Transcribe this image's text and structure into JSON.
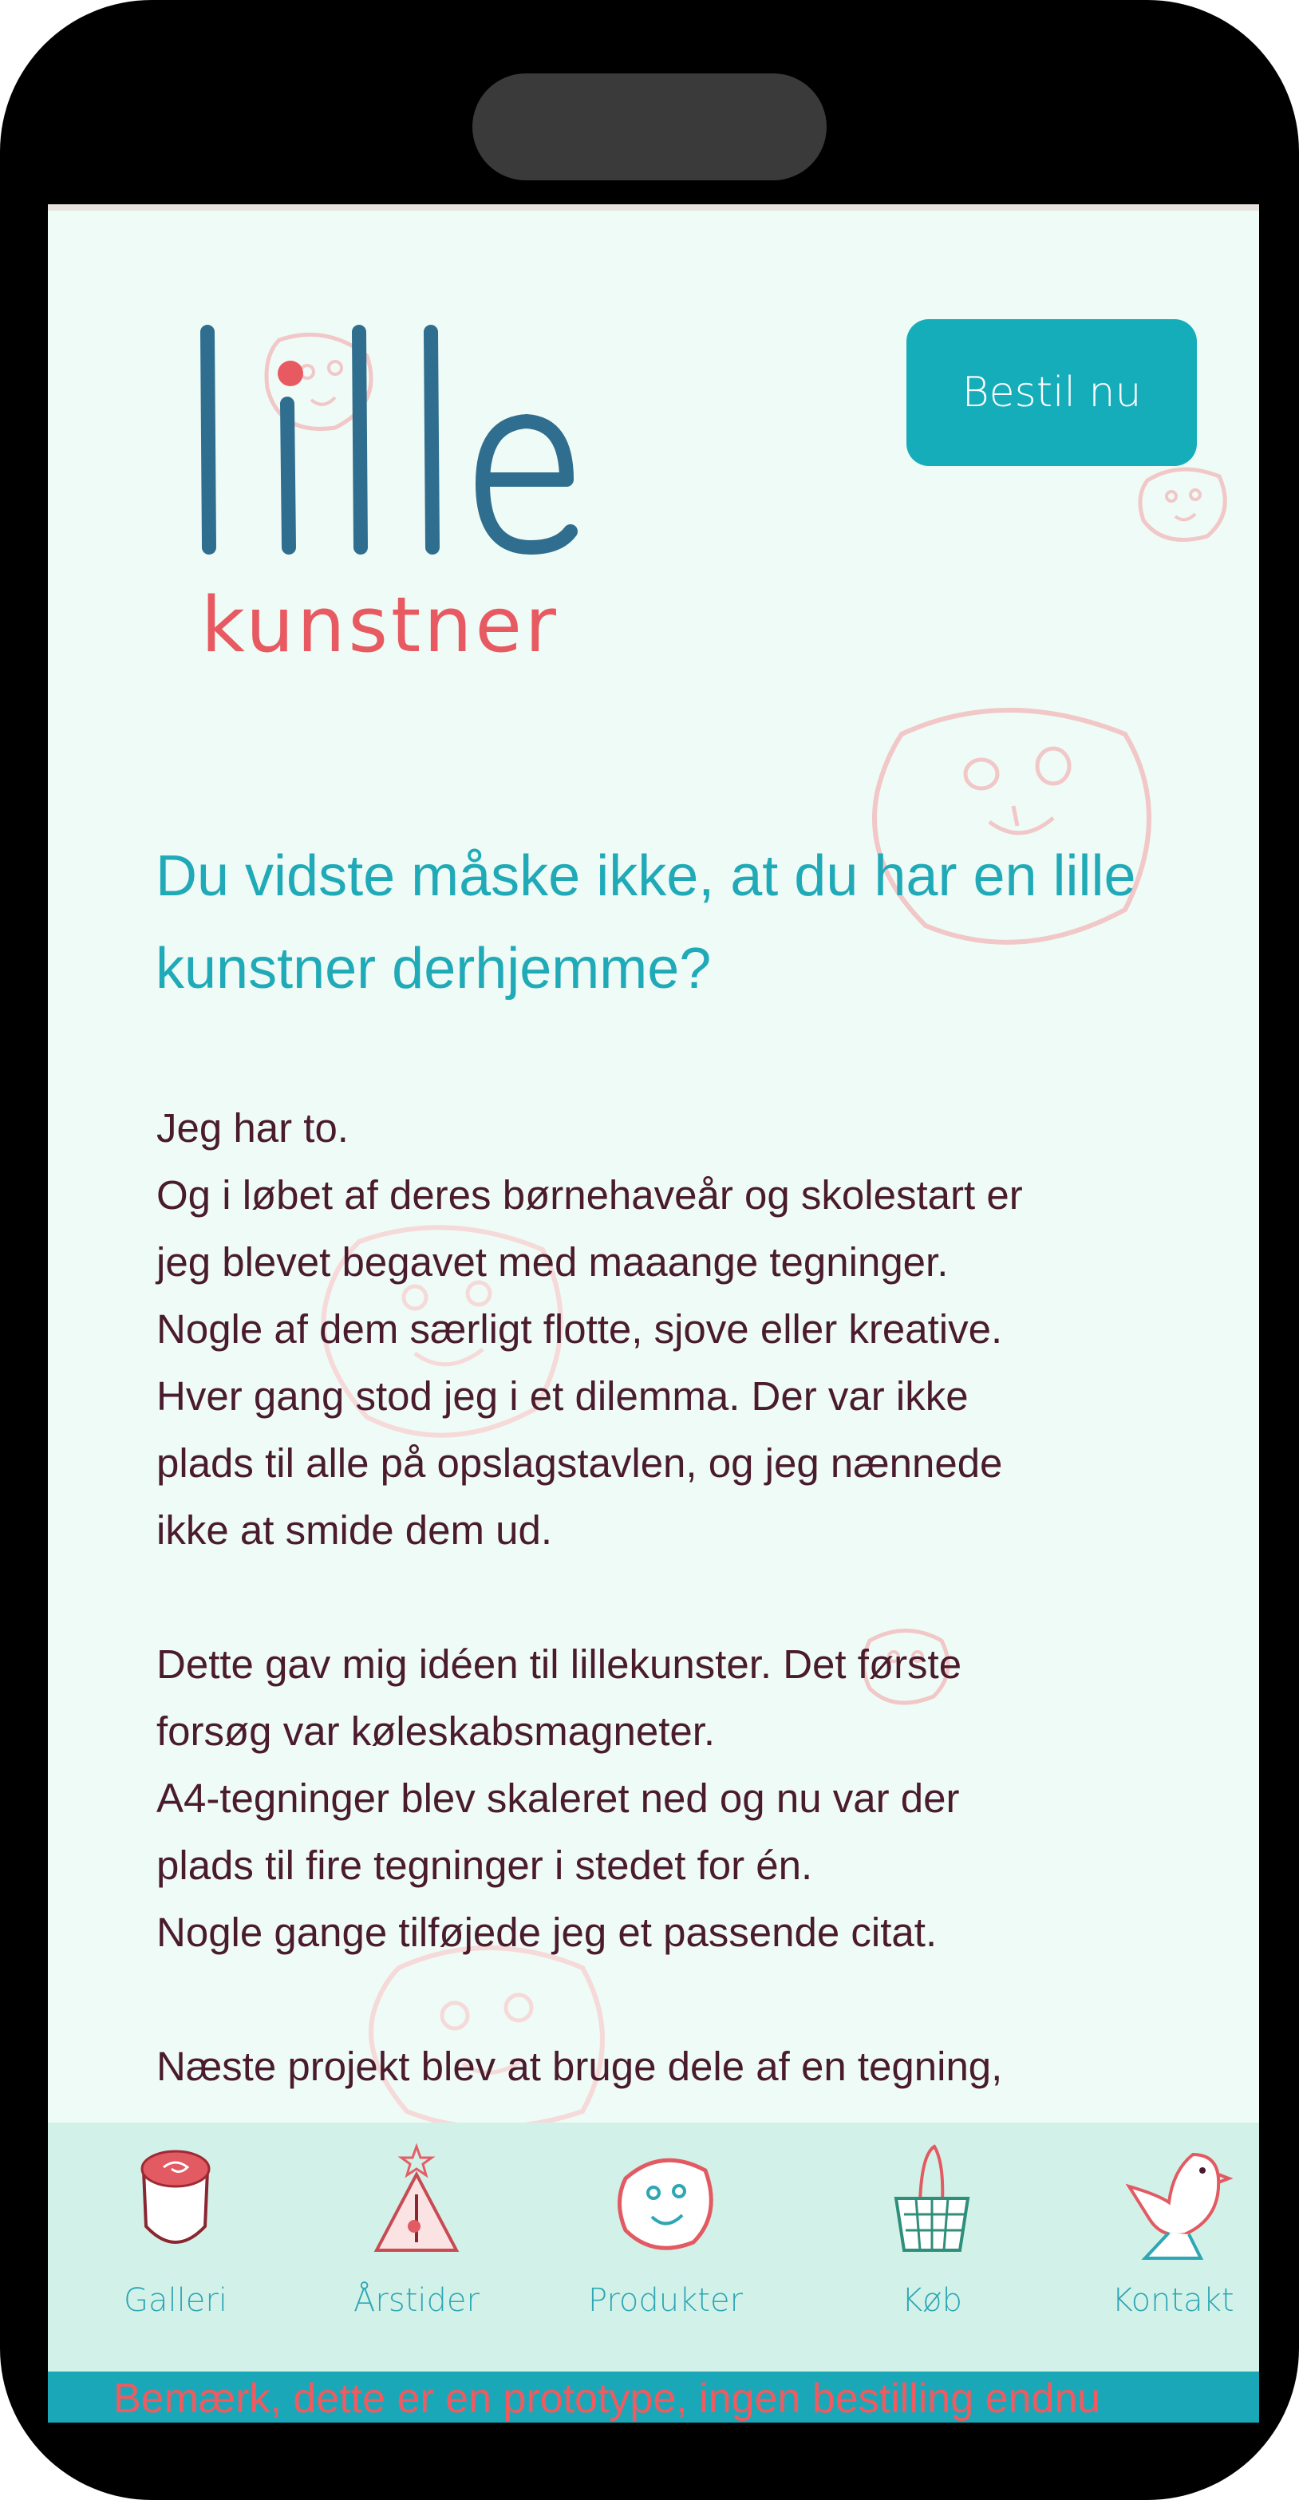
{
  "header": {
    "logo_big": "lille",
    "logo_small": "kunstner",
    "order_button": "Bestil nu"
  },
  "main": {
    "headline": "Du vidste måske ikke, at du har en lille kunstner derhjemme?",
    "paragraphs": [
      [
        "Jeg har to.",
        "Og i løbet af deres børnehaveår og skolestart er",
        "jeg blevet begavet med maaange tegninger.",
        "Nogle af dem særligt flotte, sjove eller kreative.",
        "Hver gang stod jeg i et dilemma. Der var ikke",
        "plads til alle på opslagstavlen, og jeg nænnede",
        "ikke at smide dem ud."
      ],
      [
        "Dette gav mig idéen til lillekunster. Det første",
        "forsøg var køleskabsmagneter.",
        "A4-tegninger blev skaleret ned og nu var der",
        "plads til fire tegninger i stedet for én.",
        "Nogle gange tilføjede jeg et passende citat."
      ],
      [
        "Næste projekt blev at bruge dele af en tegning,"
      ]
    ]
  },
  "nav": {
    "items": [
      {
        "label": "Galleri",
        "icon": "cup-icon"
      },
      {
        "label": "Årstider",
        "icon": "tree-icon"
      },
      {
        "label": "Produkter",
        "icon": "face-icon"
      },
      {
        "label": "Køb",
        "icon": "basket-icon"
      },
      {
        "label": "Kontakt",
        "icon": "bird-icon"
      }
    ]
  },
  "notice": "Bemærk, dette er en prototype, ingen bestilling endnu",
  "colors": {
    "accent": "#16adbb",
    "logo_blue": "#2f6e8e",
    "logo_red": "#e85a61",
    "background": "#effbf6",
    "nav_background": "#d2f2e9",
    "text": "#4a1b2d"
  }
}
